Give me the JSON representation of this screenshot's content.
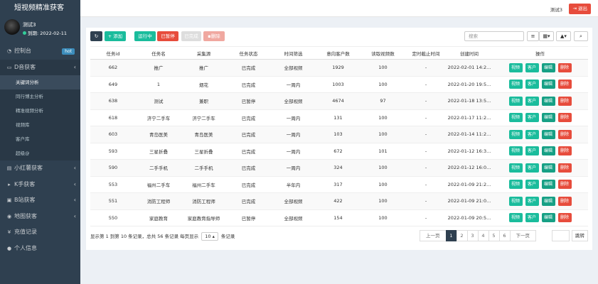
{
  "app": {
    "title": "短视频精准获客"
  },
  "user": {
    "name": "测试3",
    "expire": "到期: 2022-02-11"
  },
  "menu": {
    "dashboard": "控制台",
    "dashboard_badge": "hot",
    "douyin": "D音获客",
    "douyin_sub": [
      "关键词分析",
      "同行博主分析",
      "精准视频分析",
      "视频库",
      "客户库",
      "超级@"
    ],
    "xiaohongshu": "小红薯获客",
    "kuaishou": "K手获客",
    "bilibili": "B站获客",
    "map": "地图获客",
    "recharge": "充值记录",
    "profile": "个人信息"
  },
  "topbar": {
    "user": "测试3",
    "logout": "退出"
  },
  "toolbar": {
    "add": "添加",
    "running": "运行中",
    "paused": "已暂停",
    "done": "已完成",
    "delete": "删除",
    "search_placeholder": "搜索"
  },
  "colors": {
    "sidebar": "#2f4050",
    "primary": "#1abc9c",
    "danger": "#e74c3c"
  },
  "table": {
    "headers": [
      "任务id",
      "任务名",
      "采集源",
      "任务状态",
      "时间筛选",
      "意向客户数",
      "读取视频数",
      "定时截止时间",
      "创建时间",
      "操作"
    ],
    "actions": [
      "视频",
      "客户",
      "编辑",
      "删除"
    ],
    "rows": [
      {
        "id": "662",
        "name": "推广",
        "source": "推广",
        "status": "已完成",
        "time": "全部视频",
        "customers": "1929",
        "videos": "100",
        "deadline": "-",
        "created": "2022-02-01 14:2..."
      },
      {
        "id": "649",
        "name": "1",
        "source": "烟花",
        "status": "已完成",
        "time": "一周内",
        "customers": "1003",
        "videos": "100",
        "deadline": "-",
        "created": "2022-01-20 19:5..."
      },
      {
        "id": "638",
        "name": "测试",
        "source": "兼职",
        "status": "已暂停",
        "time": "全部视频",
        "customers": "4674",
        "videos": "97",
        "deadline": "-",
        "created": "2022-01-18 13:5..."
      },
      {
        "id": "618",
        "name": "济宁二手车",
        "source": "济宁二手车",
        "status": "已完成",
        "time": "一周内",
        "customers": "131",
        "videos": "100",
        "deadline": "-",
        "created": "2022-01-17 11:2..."
      },
      {
        "id": "603",
        "name": "青岛医美",
        "source": "青岛医美",
        "status": "已完成",
        "time": "一周内",
        "customers": "103",
        "videos": "100",
        "deadline": "-",
        "created": "2022-01-14 11:2..."
      },
      {
        "id": "593",
        "name": "三星折叠",
        "source": "三星折叠",
        "status": "已完成",
        "time": "一周内",
        "customers": "672",
        "videos": "101",
        "deadline": "-",
        "created": "2022-01-12 16:3..."
      },
      {
        "id": "590",
        "name": "二手手机",
        "source": "二手手机",
        "status": "已完成",
        "time": "一周内",
        "customers": "324",
        "videos": "100",
        "deadline": "-",
        "created": "2022-01-12 16:0..."
      },
      {
        "id": "553",
        "name": "福州二手车",
        "source": "福州二手车",
        "status": "已完成",
        "time": "半年内",
        "customers": "317",
        "videos": "100",
        "deadline": "-",
        "created": "2022-01-09 21:2..."
      },
      {
        "id": "551",
        "name": "消防工程师",
        "source": "消防工程师",
        "status": "已完成",
        "time": "全部视频",
        "customers": "422",
        "videos": "100",
        "deadline": "-",
        "created": "2022-01-09 21:0..."
      },
      {
        "id": "550",
        "name": "家庭教育",
        "source": "家庭教育指导师",
        "status": "已暂停",
        "time": "全部视频",
        "customers": "154",
        "videos": "100",
        "deadline": "-",
        "created": "2022-01-09 20:5..."
      }
    ]
  },
  "footer": {
    "info_pre": "显示第 1 到第 10 条记录，总共 56 条记录 每页显示",
    "page_size": "10",
    "info_post": "条记录",
    "pages": [
      "上一页",
      "1",
      "2",
      "3",
      "4",
      "5",
      "6",
      "下一页"
    ],
    "jump": "跳转"
  }
}
